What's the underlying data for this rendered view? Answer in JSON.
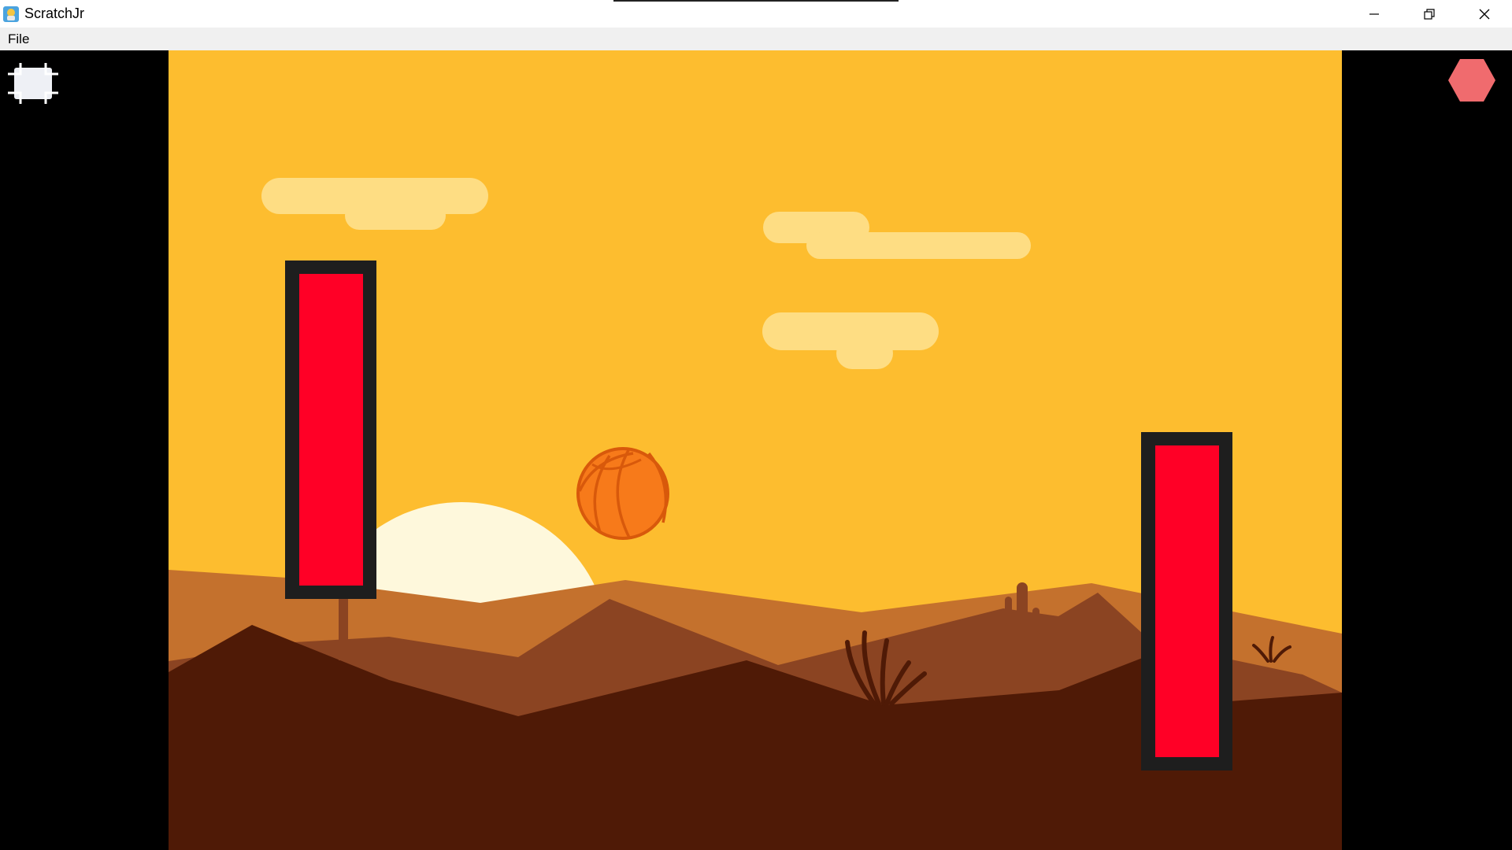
{
  "window": {
    "title": "ScratchJr",
    "controls": [
      "minimize",
      "restore",
      "close"
    ]
  },
  "menu": {
    "items": [
      {
        "label": "File"
      }
    ]
  },
  "toolbar": {
    "fullscreen_icon": "fullscreen-icon",
    "stop_icon": "stop-sign-icon"
  },
  "stage": {
    "background": "desert-sunset",
    "sprites": [
      {
        "name": "left-paddle",
        "kind": "red-rectangle"
      },
      {
        "name": "basketball",
        "kind": "ball"
      },
      {
        "name": "right-paddle",
        "kind": "red-rectangle"
      }
    ]
  },
  "colors": {
    "sky": "#FDBD2F",
    "cloud": "#FEDD83",
    "sun": "#FEF8DC",
    "paddle_fill": "#FF0026",
    "paddle_border": "#1E1E1E",
    "ball": "#F77A1A",
    "stop_button": "#F06B6E",
    "ground_dark": "#4F1A06"
  }
}
